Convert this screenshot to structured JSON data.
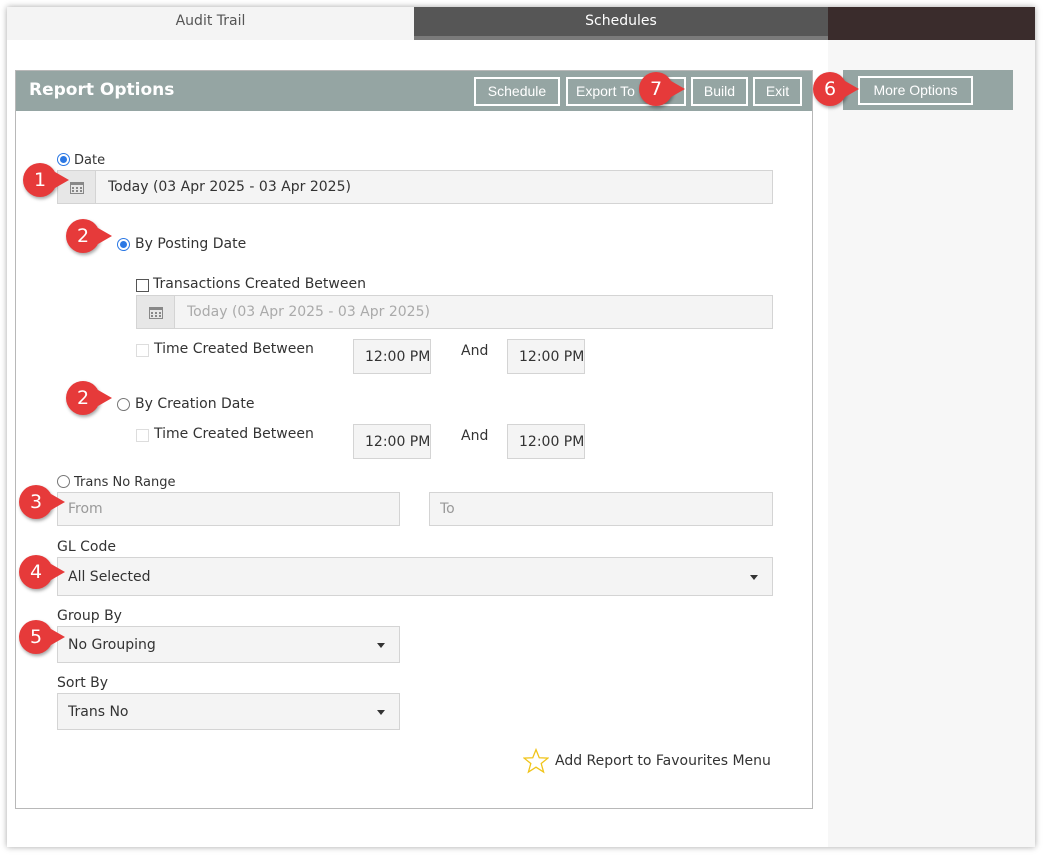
{
  "tabs": {
    "audit": "Audit Trail",
    "schedules": "Schedules"
  },
  "panel": {
    "title": "Report Options"
  },
  "toolbar": {
    "schedule": "Schedule",
    "export": "Export To",
    "build": "Build",
    "exit": "Exit",
    "more_options": "More Options"
  },
  "date": {
    "label": "Date",
    "range": "Today (03 Apr 2025 - 03 Apr 2025)",
    "by_posting_date": "By Posting Date",
    "transactions_created_between": "Transactions Created Between",
    "created_range": "Today (03 Apr 2025 - 03 Apr 2025)",
    "time_created_between": "Time Created Between",
    "time_from": "12:00 PM",
    "and": "And",
    "time_to": "12:00 PM",
    "by_creation_date": "By Creation Date",
    "creation_time_created_between": "Time Created Between",
    "creation_time_from": "12:00 PM",
    "creation_and": "And",
    "creation_time_to": "12:00 PM"
  },
  "trans_no_range": {
    "label": "Trans No Range",
    "from_placeholder": "From",
    "to_placeholder": "To"
  },
  "gl_code": {
    "label": "GL Code",
    "value": "All Selected"
  },
  "group_by": {
    "label": "Group By",
    "value": "No Grouping"
  },
  "sort_by": {
    "label": "Sort By",
    "value": "Trans No"
  },
  "favourites": {
    "label": "Add Report to Favourites Menu"
  },
  "markers": {
    "m1": "1",
    "m2a": "2",
    "m2b": "2",
    "m3": "3",
    "m4": "4",
    "m5": "5",
    "m6": "6",
    "m7": "7"
  },
  "colors": {
    "header": "#95a5a3",
    "marker": "#e63a3a",
    "radio": "#2b78e4",
    "star": "#f0c419"
  },
  "icons": {
    "calendar": "calendar-icon",
    "caret": "caret-down-icon",
    "star": "star-icon"
  }
}
